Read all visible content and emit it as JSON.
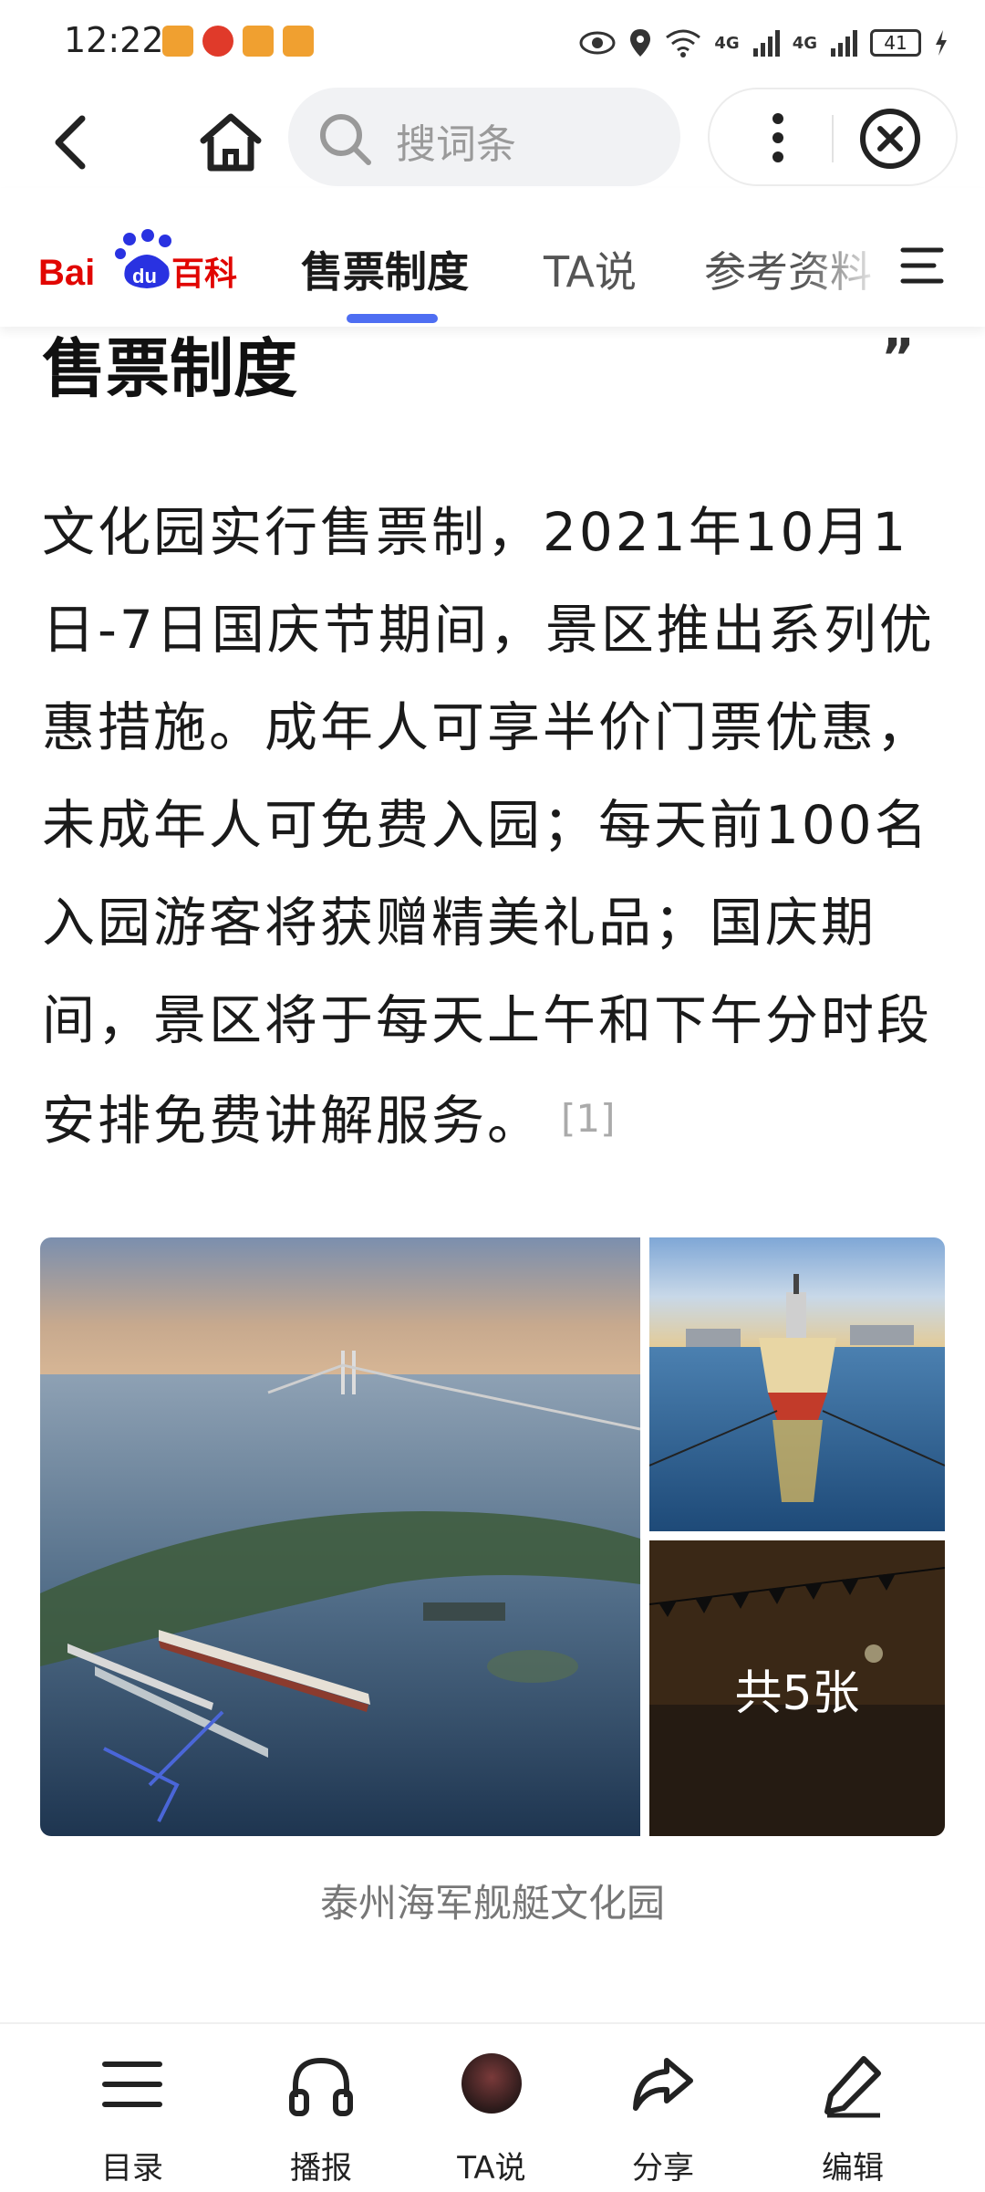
{
  "status_bar": {
    "time": "12:22",
    "net1": "4G",
    "net2": "4G",
    "battery": "41"
  },
  "nav": {
    "search_placeholder": "搜词条"
  },
  "tabs": [
    {
      "label": "售票制度",
      "active": true
    },
    {
      "label": "TA说",
      "active": false
    },
    {
      "label": "参考资料",
      "active": false
    }
  ],
  "brand": {
    "logo_text_left": "Bai",
    "logo_text_du": "du",
    "logo_text_right": "百科",
    "accent": "#e10602",
    "blue": "#2932e1",
    "tab_indicator": "#4e6ef2"
  },
  "section": {
    "title": "售票制度",
    "paragraph": "文化园实行售票制，2021年10月1日-7日国庆节期间，景区推出系列优惠措施。成年人可享半价门票优惠，未成年人可免费入园；每天前100名入园游客将获赠精美礼品；国庆期间，景区将于每天上午和下午分时段安排免费讲解服务。",
    "citation": "[1]"
  },
  "gallery": {
    "more_label": "共5张",
    "caption": "泰州海军舰艇文化园"
  },
  "toolbar": {
    "items": [
      {
        "label": "目录",
        "icon": "list-icon"
      },
      {
        "label": "播报",
        "icon": "headphones-icon"
      },
      {
        "label": "TA说",
        "icon": "avatar"
      },
      {
        "label": "分享",
        "icon": "share-icon"
      },
      {
        "label": "编辑",
        "icon": "edit-icon"
      }
    ]
  }
}
